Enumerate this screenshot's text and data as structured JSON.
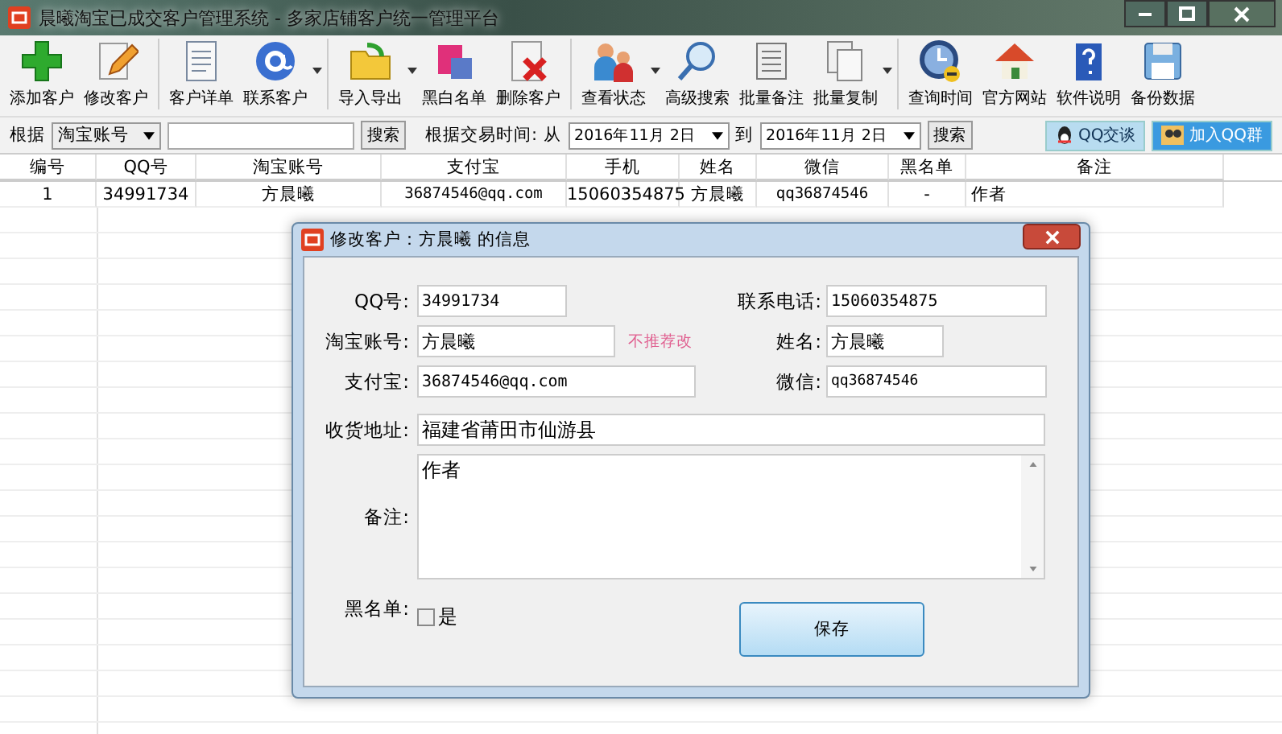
{
  "window": {
    "title": "晨曦淘宝已成交客户管理系统 - 多家店铺客户统一管理平台"
  },
  "toolbar": [
    {
      "label": "添加客户",
      "kind": "plus",
      "dropdown": false,
      "separator_before": false
    },
    {
      "label": "修改客户",
      "kind": "pencil",
      "dropdown": false,
      "separator_before": false
    },
    {
      "label": "客户详单",
      "kind": "document",
      "dropdown": false,
      "separator_before": true
    },
    {
      "label": "联系客户",
      "kind": "at",
      "dropdown": true,
      "separator_before": false
    },
    {
      "label": "导入导出",
      "kind": "folder",
      "dropdown": true,
      "separator_before": true
    },
    {
      "label": "黑白名单",
      "kind": "cards",
      "dropdown": false,
      "separator_before": false
    },
    {
      "label": "删除客户",
      "kind": "delete",
      "dropdown": false,
      "separator_before": false
    },
    {
      "label": "查看状态",
      "kind": "people",
      "dropdown": true,
      "separator_before": true
    },
    {
      "label": "高级搜索",
      "kind": "magnifier",
      "dropdown": false,
      "separator_before": false
    },
    {
      "label": "批量备注",
      "kind": "scroll",
      "dropdown": false,
      "separator_before": false
    },
    {
      "label": "批量复制",
      "kind": "copies",
      "dropdown": true,
      "separator_before": false
    },
    {
      "label": "查询时间",
      "kind": "clock",
      "dropdown": false,
      "separator_before": true
    },
    {
      "label": "官方网站",
      "kind": "house",
      "dropdown": false,
      "separator_before": false
    },
    {
      "label": "软件说明",
      "kind": "help",
      "dropdown": false,
      "separator_before": false
    },
    {
      "label": "备份数据",
      "kind": "floppy",
      "dropdown": false,
      "separator_before": false
    }
  ],
  "search": {
    "by_label": "根据",
    "by_value": "淘宝账号",
    "button": "搜索",
    "date_label": "根据交易时间:",
    "from_label": "从",
    "from_date": "2016年11月 2日",
    "to_label": "到",
    "to_date": "2016年11月 2日",
    "date_button": "搜索",
    "qq_chat": "QQ交谈",
    "join_group": "加入QQ群"
  },
  "table": {
    "columns": [
      "编号",
      "QQ号",
      "淘宝账号",
      "支付宝",
      "手机",
      "姓名",
      "微信",
      "黑名单",
      "备注"
    ],
    "rows": [
      [
        "1",
        "34991734",
        "方晨曦",
        "36874546@qq.com",
        "15060354875",
        "方晨曦",
        "qq36874546",
        "-",
        "作者"
      ]
    ]
  },
  "dialog": {
    "title": "修改客户：方晨曦 的信息",
    "qq_label": "QQ号:",
    "qq": "34991734",
    "phone_label": "联系电话:",
    "phone": "15060354875",
    "taobao_label": "淘宝账号:",
    "taobao": "方晨曦",
    "taobao_hint": "不推荐改",
    "name_label": "姓名:",
    "name": "方晨曦",
    "alipay_label": "支付宝:",
    "alipay": "36874546@qq.com",
    "wechat_label": "微信:",
    "wechat": "qq36874546",
    "address_label": "收货地址:",
    "address": "福建省莆田市仙游县",
    "memo_label": "备注:",
    "memo": "作者",
    "blacklist_label": "黑名单:",
    "blacklist_option": "是",
    "blacklisted": false,
    "save": "保存"
  }
}
